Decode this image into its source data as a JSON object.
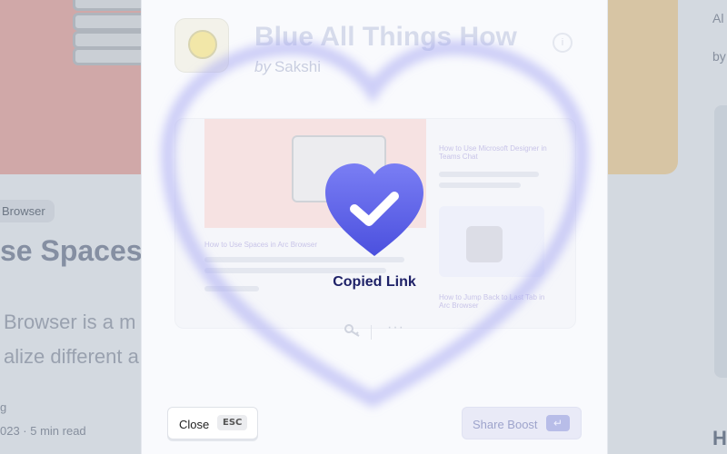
{
  "background": {
    "tag": "Browser",
    "title": "se Spaces",
    "desc_line1": "Browser is a m",
    "desc_line2": "alize different a",
    "meta_line1": "g",
    "meta_line2": "023 · 5 min read",
    "right_snippet_top": "Al",
    "right_snippet_mid": "by",
    "right_snippet_bottom": "H"
  },
  "modal": {
    "title": "Blue All Things How",
    "by_prefix": "by",
    "author": "Sakshi",
    "info_icon": "i",
    "preview": {
      "article_left_title": "How to Use Spaces in Arc Browser",
      "article_right_title": "How to Use Microsoft Designer in Teams Chat",
      "article_bottom_title": "How to Jump Back to Last Tab in Arc Browser"
    },
    "actions": {
      "key_icon": "key-icon",
      "more_icon": "···"
    }
  },
  "toast": {
    "label": "Copied Link"
  },
  "buttons": {
    "close_label": "Close",
    "close_shortcut": "ESC",
    "share_label": "Share Boost",
    "share_shortcut": "↵"
  },
  "colors": {
    "heart_gradient_top": "#6e72f0",
    "heart_gradient_bottom": "#4a4fe0",
    "toast_text": "#1e2167",
    "glow": "#8a8ff0"
  }
}
